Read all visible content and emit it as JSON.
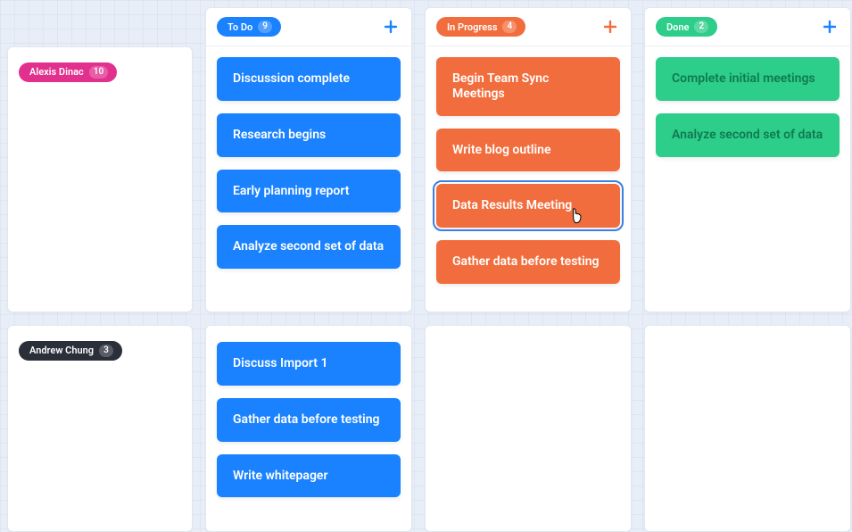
{
  "people": [
    {
      "name": "Alexis Dinac",
      "count": 10,
      "color": "pink"
    },
    {
      "name": "Andrew Chung",
      "count": 3,
      "color": "dark"
    }
  ],
  "columns": [
    {
      "id": "todo",
      "label": "To Do",
      "count": 9,
      "pill_color": "blue",
      "plus_color": "#1a82ff",
      "rows": [
        {
          "card_color": "blue",
          "cards": [
            "Discussion complete",
            "Research begins",
            "Early planning report",
            "Analyze second set of data"
          ]
        },
        {
          "card_color": "blue",
          "cards": [
            "Discuss Import 1",
            "Gather data before testing",
            "Write whitepager"
          ]
        }
      ]
    },
    {
      "id": "in-progress",
      "label": "In Progress",
      "count": 4,
      "pill_color": "orange",
      "plus_color": "#f26d3d",
      "rows": [
        {
          "card_color": "orange",
          "highlight_index": 2,
          "cards": [
            "Begin Team Sync Meetings",
            "Write blog outline",
            "Data Results Meeting",
            "Gather data before testing"
          ]
        },
        {
          "card_color": "orange",
          "cards": []
        }
      ]
    },
    {
      "id": "done",
      "label": "Done",
      "count": 2,
      "pill_color": "green",
      "plus_color": "#1a82ff",
      "rows": [
        {
          "card_color": "green",
          "cards": [
            "Complete initial meetings",
            "Analyze second set of data"
          ]
        },
        {
          "card_color": "green",
          "cards": []
        }
      ]
    }
  ]
}
